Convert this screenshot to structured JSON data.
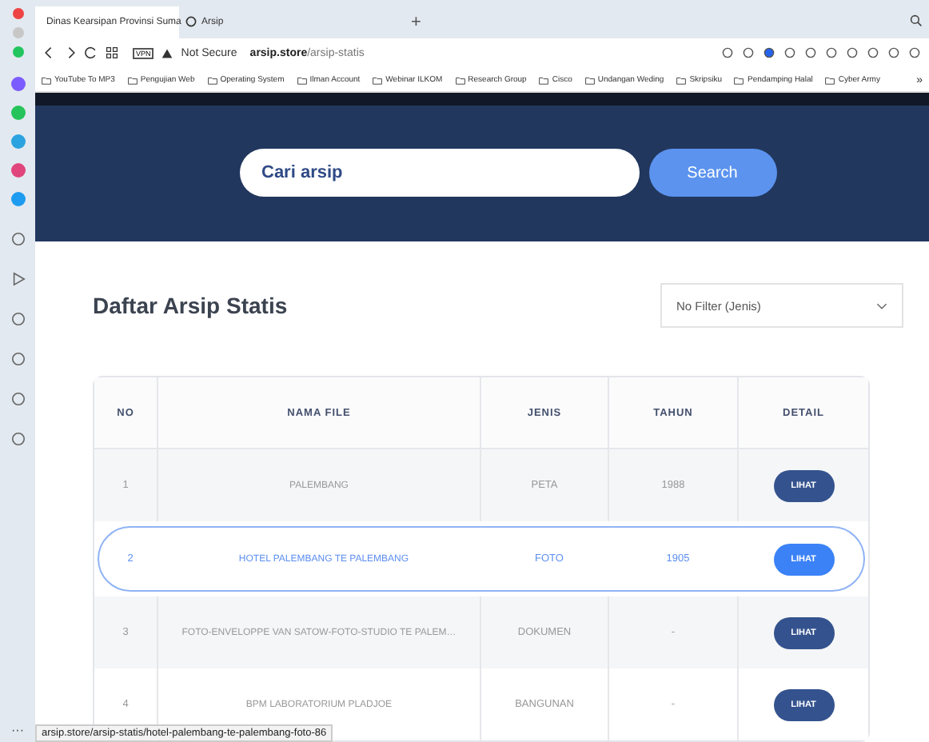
{
  "browser": {
    "tabs": [
      {
        "title": "Dinas Kearsipan Provinsi Suma",
        "selected": true
      },
      {
        "title": "Arsip",
        "selected": false
      }
    ],
    "new_tab": "+",
    "vpn": "VPN",
    "security": "Not Secure",
    "domain": "arsip.store",
    "path": "/arsip-statis",
    "bookmarks": [
      "YouTube To MP3",
      "Pengujian Web",
      "Operating System",
      "Ilman Account",
      "Webinar ILKOM",
      "Research Group",
      "Cisco",
      "Undangan Weding",
      "Skripsiku",
      "Pendamping Halal",
      "Cyber Army"
    ],
    "bookmarks_more": "»",
    "sidebar_more": "···",
    "status_url": "arsip.store/arsip-statis/hotel-palembang-te-palembang-foto-86"
  },
  "search": {
    "placeholder": "Cari arsip",
    "button": "Search"
  },
  "heading": "Daftar Arsip Statis",
  "filter": {
    "value": "No Filter (Jenis)"
  },
  "table": {
    "columns": [
      "NO",
      "NAMA FILE",
      "JENIS",
      "TAHUN",
      "DETAIL"
    ],
    "rows": [
      {
        "no": "1",
        "name": "PALEMBANG",
        "type": "PETA",
        "year": "1988",
        "action": "LIHAT",
        "selected": false
      },
      {
        "no": "2",
        "name": "HOTEL PALEMBANG TE PALEMBANG",
        "type": "FOTO",
        "year": "1905",
        "action": "LIHAT",
        "selected": true
      },
      {
        "no": "3",
        "name": "FOTO-ENVELOPPE VAN SATOW-FOTO-STUDIO TE PALEM…",
        "type": "DOKUMEN",
        "year": "-",
        "action": "LIHAT",
        "selected": false
      },
      {
        "no": "4",
        "name": "BPM LABORATORIUM PLADJOE",
        "type": "BANGUNAN",
        "year": "-",
        "action": "LIHAT",
        "selected": false
      }
    ]
  }
}
